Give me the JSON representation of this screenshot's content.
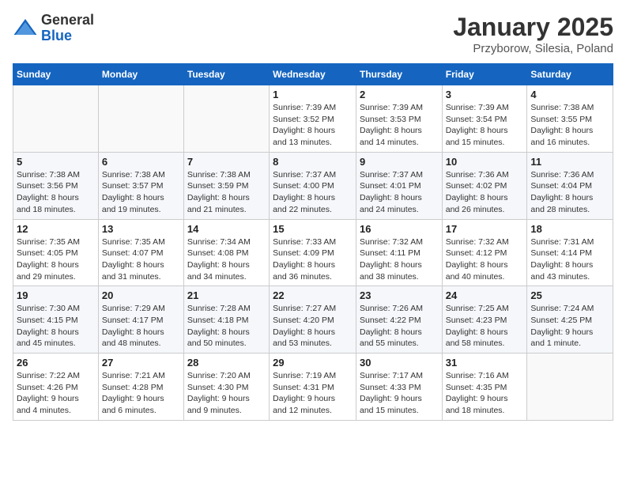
{
  "header": {
    "logo_general": "General",
    "logo_blue": "Blue",
    "title": "January 2025",
    "subtitle": "Przyborow, Silesia, Poland"
  },
  "days_of_week": [
    "Sunday",
    "Monday",
    "Tuesday",
    "Wednesday",
    "Thursday",
    "Friday",
    "Saturday"
  ],
  "weeks": [
    [
      {
        "day": "",
        "info": ""
      },
      {
        "day": "",
        "info": ""
      },
      {
        "day": "",
        "info": ""
      },
      {
        "day": "1",
        "info": "Sunrise: 7:39 AM\nSunset: 3:52 PM\nDaylight: 8 hours\nand 13 minutes."
      },
      {
        "day": "2",
        "info": "Sunrise: 7:39 AM\nSunset: 3:53 PM\nDaylight: 8 hours\nand 14 minutes."
      },
      {
        "day": "3",
        "info": "Sunrise: 7:39 AM\nSunset: 3:54 PM\nDaylight: 8 hours\nand 15 minutes."
      },
      {
        "day": "4",
        "info": "Sunrise: 7:38 AM\nSunset: 3:55 PM\nDaylight: 8 hours\nand 16 minutes."
      }
    ],
    [
      {
        "day": "5",
        "info": "Sunrise: 7:38 AM\nSunset: 3:56 PM\nDaylight: 8 hours\nand 18 minutes."
      },
      {
        "day": "6",
        "info": "Sunrise: 7:38 AM\nSunset: 3:57 PM\nDaylight: 8 hours\nand 19 minutes."
      },
      {
        "day": "7",
        "info": "Sunrise: 7:38 AM\nSunset: 3:59 PM\nDaylight: 8 hours\nand 21 minutes."
      },
      {
        "day": "8",
        "info": "Sunrise: 7:37 AM\nSunset: 4:00 PM\nDaylight: 8 hours\nand 22 minutes."
      },
      {
        "day": "9",
        "info": "Sunrise: 7:37 AM\nSunset: 4:01 PM\nDaylight: 8 hours\nand 24 minutes."
      },
      {
        "day": "10",
        "info": "Sunrise: 7:36 AM\nSunset: 4:02 PM\nDaylight: 8 hours\nand 26 minutes."
      },
      {
        "day": "11",
        "info": "Sunrise: 7:36 AM\nSunset: 4:04 PM\nDaylight: 8 hours\nand 28 minutes."
      }
    ],
    [
      {
        "day": "12",
        "info": "Sunrise: 7:35 AM\nSunset: 4:05 PM\nDaylight: 8 hours\nand 29 minutes."
      },
      {
        "day": "13",
        "info": "Sunrise: 7:35 AM\nSunset: 4:07 PM\nDaylight: 8 hours\nand 31 minutes."
      },
      {
        "day": "14",
        "info": "Sunrise: 7:34 AM\nSunset: 4:08 PM\nDaylight: 8 hours\nand 34 minutes."
      },
      {
        "day": "15",
        "info": "Sunrise: 7:33 AM\nSunset: 4:09 PM\nDaylight: 8 hours\nand 36 minutes."
      },
      {
        "day": "16",
        "info": "Sunrise: 7:32 AM\nSunset: 4:11 PM\nDaylight: 8 hours\nand 38 minutes."
      },
      {
        "day": "17",
        "info": "Sunrise: 7:32 AM\nSunset: 4:12 PM\nDaylight: 8 hours\nand 40 minutes."
      },
      {
        "day": "18",
        "info": "Sunrise: 7:31 AM\nSunset: 4:14 PM\nDaylight: 8 hours\nand 43 minutes."
      }
    ],
    [
      {
        "day": "19",
        "info": "Sunrise: 7:30 AM\nSunset: 4:15 PM\nDaylight: 8 hours\nand 45 minutes."
      },
      {
        "day": "20",
        "info": "Sunrise: 7:29 AM\nSunset: 4:17 PM\nDaylight: 8 hours\nand 48 minutes."
      },
      {
        "day": "21",
        "info": "Sunrise: 7:28 AM\nSunset: 4:18 PM\nDaylight: 8 hours\nand 50 minutes."
      },
      {
        "day": "22",
        "info": "Sunrise: 7:27 AM\nSunset: 4:20 PM\nDaylight: 8 hours\nand 53 minutes."
      },
      {
        "day": "23",
        "info": "Sunrise: 7:26 AM\nSunset: 4:22 PM\nDaylight: 8 hours\nand 55 minutes."
      },
      {
        "day": "24",
        "info": "Sunrise: 7:25 AM\nSunset: 4:23 PM\nDaylight: 8 hours\nand 58 minutes."
      },
      {
        "day": "25",
        "info": "Sunrise: 7:24 AM\nSunset: 4:25 PM\nDaylight: 9 hours\nand 1 minute."
      }
    ],
    [
      {
        "day": "26",
        "info": "Sunrise: 7:22 AM\nSunset: 4:26 PM\nDaylight: 9 hours\nand 4 minutes."
      },
      {
        "day": "27",
        "info": "Sunrise: 7:21 AM\nSunset: 4:28 PM\nDaylight: 9 hours\nand 6 minutes."
      },
      {
        "day": "28",
        "info": "Sunrise: 7:20 AM\nSunset: 4:30 PM\nDaylight: 9 hours\nand 9 minutes."
      },
      {
        "day": "29",
        "info": "Sunrise: 7:19 AM\nSunset: 4:31 PM\nDaylight: 9 hours\nand 12 minutes."
      },
      {
        "day": "30",
        "info": "Sunrise: 7:17 AM\nSunset: 4:33 PM\nDaylight: 9 hours\nand 15 minutes."
      },
      {
        "day": "31",
        "info": "Sunrise: 7:16 AM\nSunset: 4:35 PM\nDaylight: 9 hours\nand 18 minutes."
      },
      {
        "day": "",
        "info": ""
      }
    ]
  ]
}
